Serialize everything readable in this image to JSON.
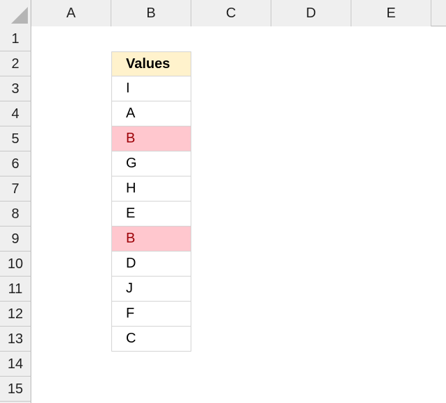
{
  "columns": [
    "A",
    "B",
    "C",
    "D",
    "E"
  ],
  "rows": [
    "1",
    "2",
    "3",
    "4",
    "5",
    "6",
    "7",
    "8",
    "9",
    "10",
    "11",
    "12",
    "13",
    "14",
    "15"
  ],
  "table": {
    "header": "Values",
    "values": [
      "I",
      "A",
      "B",
      "G",
      "H",
      "E",
      "B",
      "D",
      "J",
      "F",
      "C"
    ],
    "duplicate_value": "B"
  },
  "colors": {
    "header_fill": "#fff2cc",
    "duplicate_fill": "#ffc7ce",
    "duplicate_text": "#9c0006",
    "normal_text": "#000000"
  }
}
